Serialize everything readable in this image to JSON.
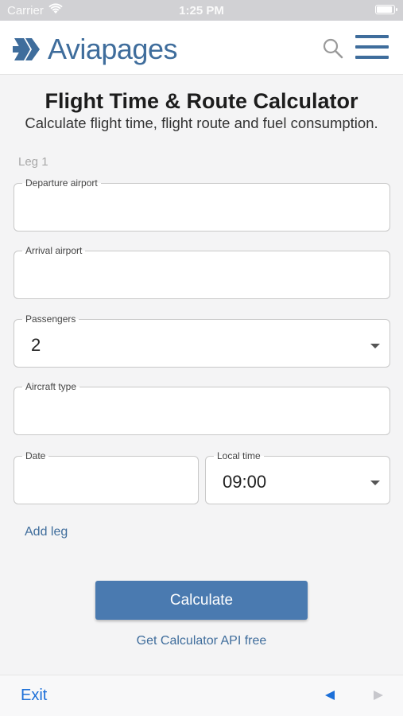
{
  "status": {
    "carrier": "Carrier",
    "time": "1:25 PM"
  },
  "header": {
    "logo_text": "Aviapages",
    "brand_color": "#3f6d9c"
  },
  "page": {
    "title": "Flight Time & Route Calculator",
    "subtitle": "Calculate flight time, flight route and fuel consumption.",
    "leg_label": "Leg 1"
  },
  "form": {
    "departure": {
      "label": "Departure airport",
      "value": ""
    },
    "arrival": {
      "label": "Arrival airport",
      "value": ""
    },
    "passengers": {
      "label": "Passengers",
      "value": "2"
    },
    "aircraft": {
      "label": "Aircraft type",
      "value": ""
    },
    "date": {
      "label": "Date",
      "value": ""
    },
    "local_time": {
      "label": "Local time",
      "value": "09:00"
    }
  },
  "actions": {
    "add_leg": "Add leg",
    "calculate": "Calculate",
    "api_link": "Get Calculator API free"
  },
  "browser": {
    "exit": "Exit"
  }
}
